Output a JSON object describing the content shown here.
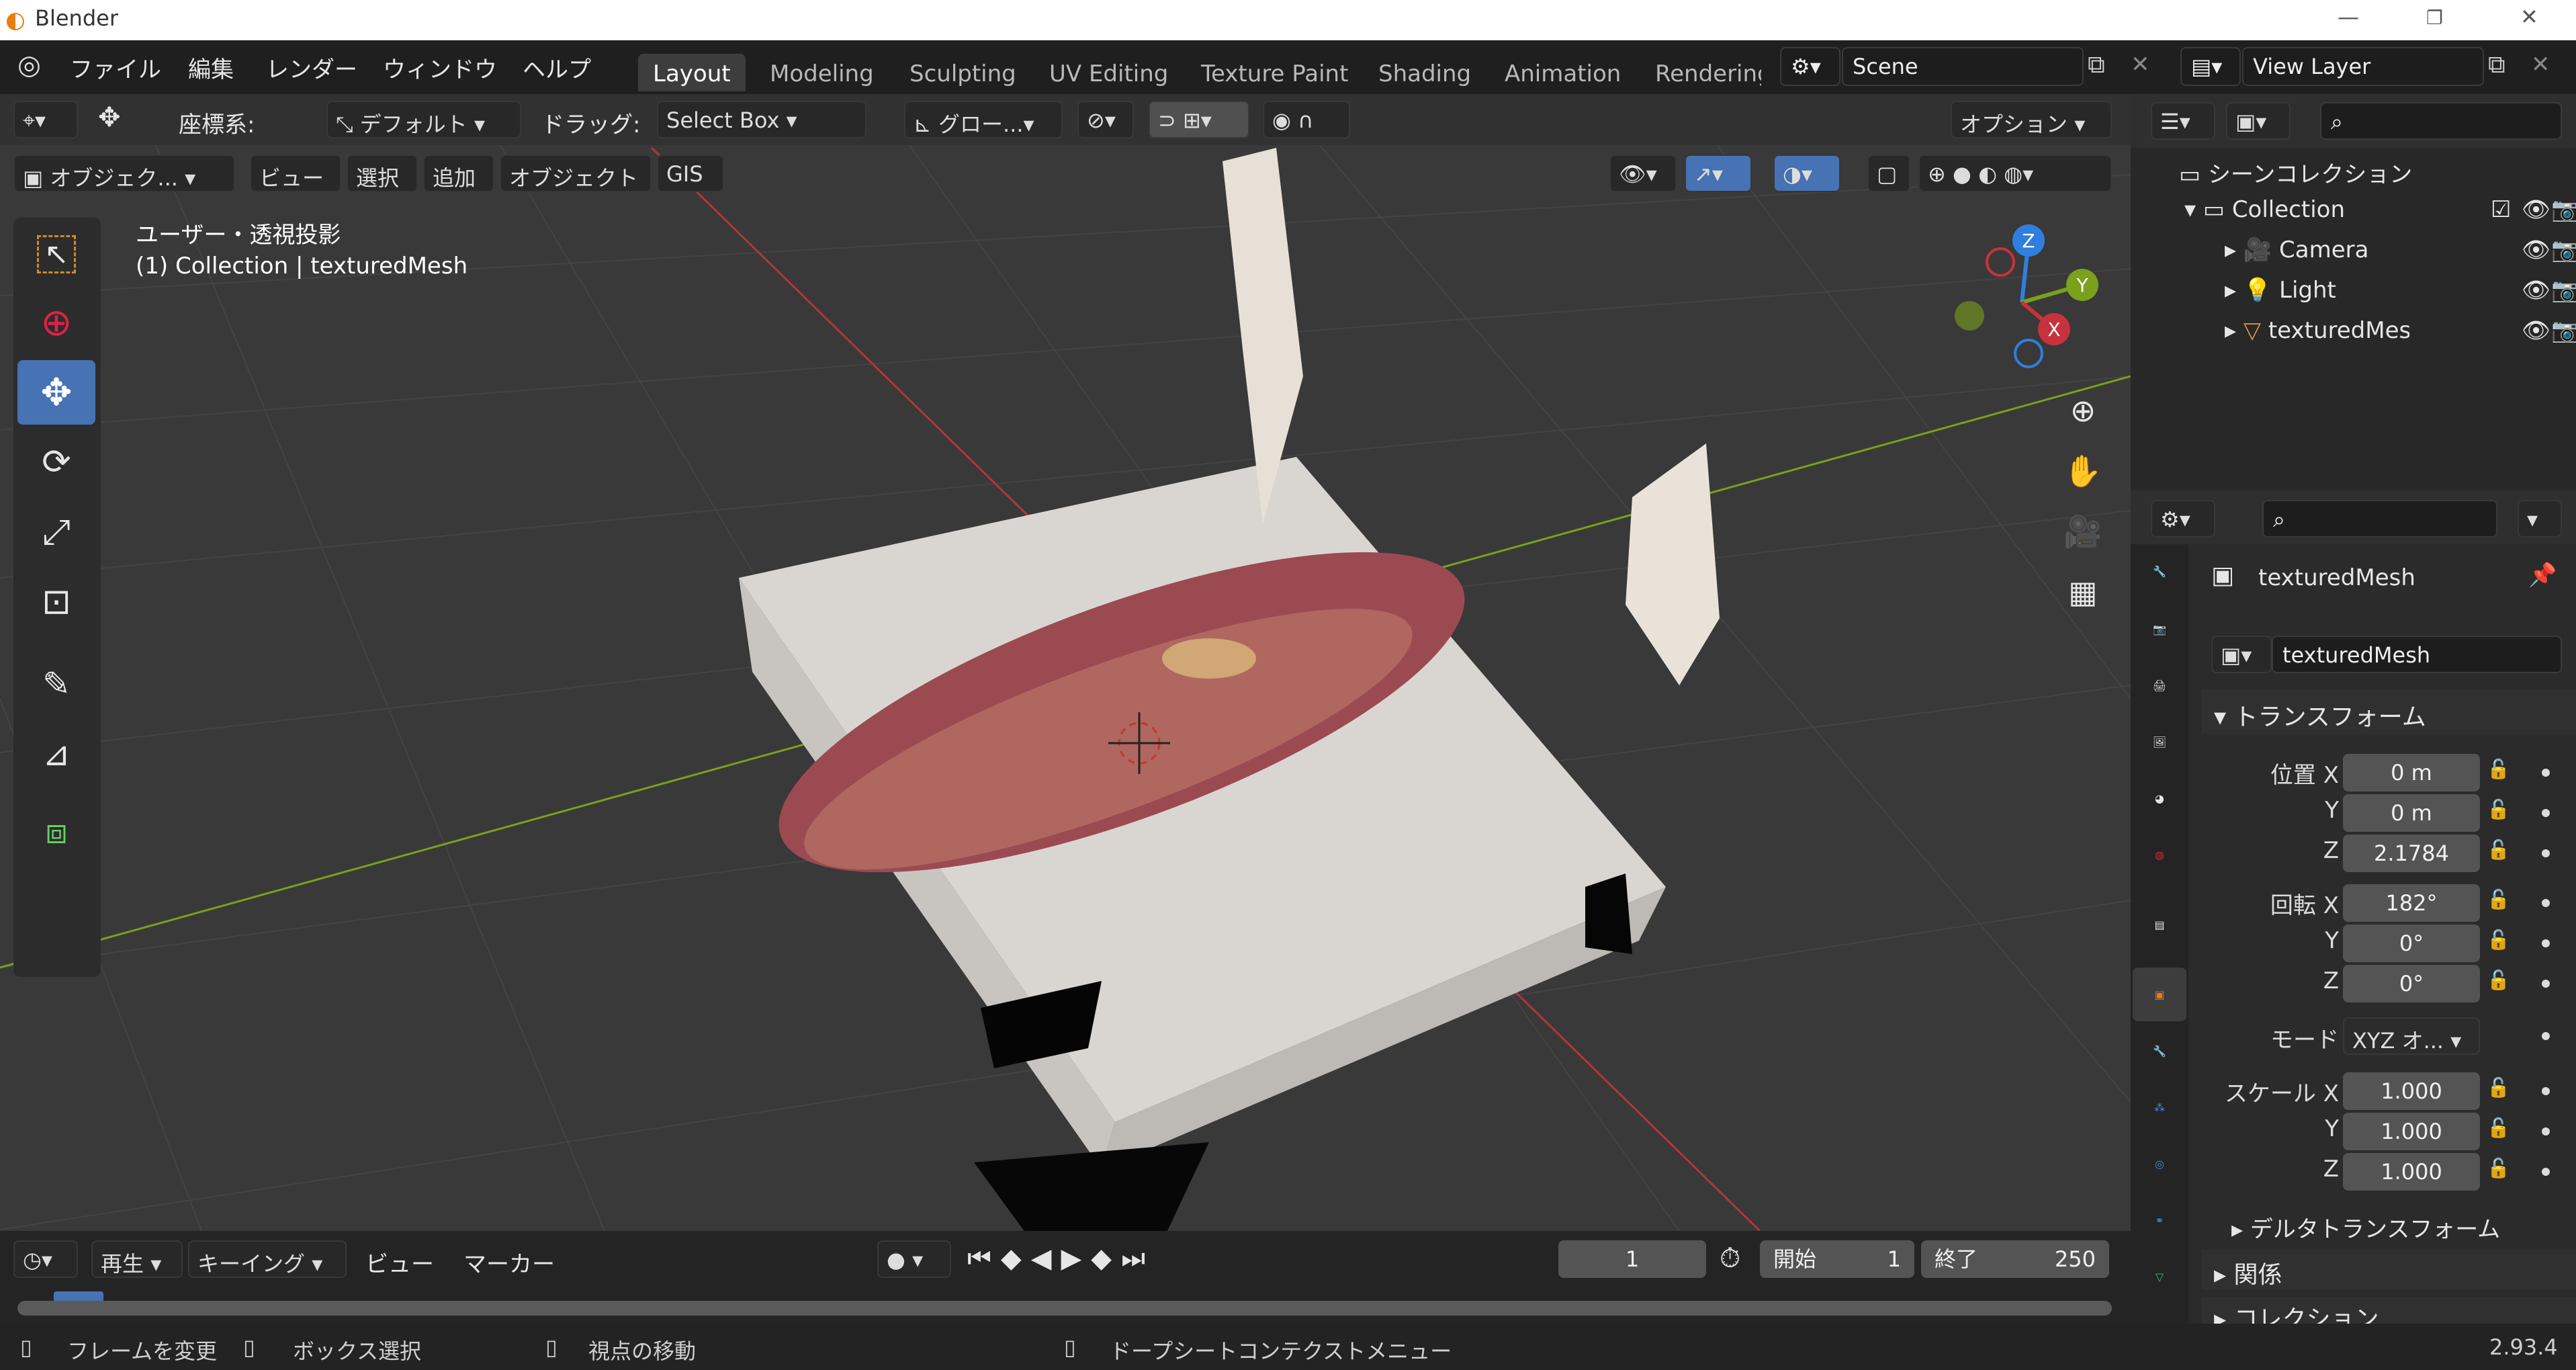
{
  "window": {
    "title": "Blender",
    "version": "2.93.4"
  },
  "menu": [
    "ファイル",
    "編集",
    "レンダー",
    "ウィンドウ",
    "ヘルプ"
  ],
  "workspaces": [
    "Layout",
    "Modeling",
    "Sculpting",
    "UV Editing",
    "Texture Paint",
    "Shading",
    "Animation",
    "Rendering"
  ],
  "scene": {
    "name": "Scene",
    "view_layer": "View Layer"
  },
  "toolheader": {
    "coord_label": "座標系:",
    "coord_value": "デフォルト",
    "drag_label": "ドラッグ:",
    "drag_value": "Select Box",
    "transform": "グロー...",
    "options": "オプション"
  },
  "viewport_menu": {
    "mode": "オブジェク...",
    "items": [
      "ビュー",
      "選択",
      "追加",
      "オブジェクト",
      "GIS"
    ]
  },
  "viewport": {
    "view_name": "ユーザー・透視投影",
    "collection_info": "(1) Collection | texturedMesh"
  },
  "gizmo": {
    "x": "X",
    "y": "Y",
    "z": "Z"
  },
  "outliner": {
    "root": "シーンコレクション",
    "collection": "Collection",
    "items": [
      "Camera",
      "Light",
      "texturedMesh"
    ]
  },
  "properties": {
    "object_name": "texturedMesh",
    "data_name": "texturedMesh",
    "transform_panel": "トランスフォーム",
    "location_label": "位置 X",
    "location": [
      "0 m",
      "0 m",
      "2.1784"
    ],
    "rotation_label": "回転 X",
    "rotation": [
      "182°",
      "0°",
      "0°"
    ],
    "axis_y": "Y",
    "axis_z": "Z",
    "mode_label": "モード",
    "mode_value": "XYZ オ...",
    "scale_label": "スケール X",
    "scale": [
      "1.000",
      "1.000",
      "1.000"
    ],
    "delta": "デルタトランスフォーム",
    "relations": "関係",
    "collections": "コレクション"
  },
  "timeline": {
    "play": "再生",
    "keying": "キーイング",
    "view": "ビュー",
    "marker": "マーカー",
    "current": "1",
    "start_label": "開始",
    "start": "1",
    "end_label": "終了",
    "end": "250"
  },
  "statusbar": {
    "frame": "フレームを変更",
    "box": "ボックス選択",
    "move": "視点の移動",
    "context": "ドープシートコンテクストメニュー"
  },
  "colors": {
    "accent": "#4772b3",
    "x_axis": "#c8323c",
    "y_axis": "#7aa01c",
    "z_axis": "#2f7fe0"
  }
}
